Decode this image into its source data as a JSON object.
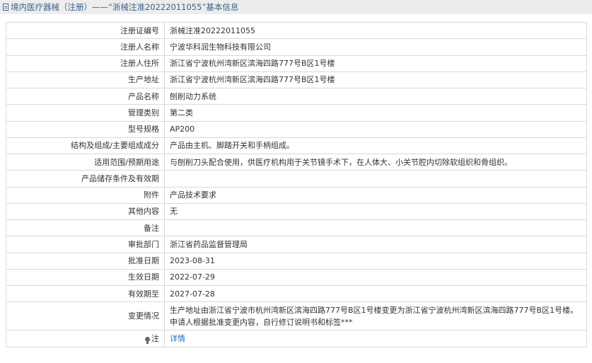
{
  "header": {
    "title": "境内医疗器械（注册）——“浙械注准20222011055”基本信息",
    "icon": "document-icon"
  },
  "rows": [
    {
      "label": "注册证编号",
      "value": "浙械注准20222011055"
    },
    {
      "label": "注册人名称",
      "value": "宁波华科润生物科技有限公司"
    },
    {
      "label": "注册人住所",
      "value": "浙江省宁波杭州湾新区滨海四路777号B区1号楼"
    },
    {
      "label": "生产地址",
      "value": "浙江省宁波杭州湾新区滨海四路777号B区1号楼"
    },
    {
      "label": "产品名称",
      "value": "刨削动力系统"
    },
    {
      "label": "管理类别",
      "value": "第二类"
    },
    {
      "label": "型号规格",
      "value": "AP200"
    },
    {
      "label": "结构及组成/主要组成成分",
      "value": "产品由主机、脚踏开关和手柄组成。"
    },
    {
      "label": "适用范围/预期用途",
      "value": "与刨削刀头配合使用，供医疗机构用于关节镜手术下，在人体大、小关节腔内切除软组织和骨组织。"
    },
    {
      "label": "产品储存条件及有效期",
      "value": ""
    },
    {
      "label": "附件",
      "value": "产品技术要求"
    },
    {
      "label": "其他内容",
      "value": "无"
    },
    {
      "label": "备注",
      "value": ""
    },
    {
      "label": "审批部门",
      "value": "浙江省药品监督管理局"
    },
    {
      "label": "批准日期",
      "value": "2023-08-31"
    },
    {
      "label": "生效日期",
      "value": "2022-07-29"
    },
    {
      "label": "有效期至",
      "value": "2027-07-28"
    },
    {
      "label": "变更情况",
      "value": "生产地址由浙江省宁波市杭州湾新区滨海四路777号B区1号楼变更为浙江省宁波杭州湾新区滨海四路777号B区1号楼。申请人根据批准变更内容，自行修订说明书和标签***"
    }
  ],
  "footer_row": {
    "label": "注",
    "link_text": "详情",
    "icon": "lightbulb-icon"
  },
  "colors": {
    "title_bar_bg": "#ededed",
    "title_text": "#3a5f8a",
    "border": "#d9d9d9",
    "link": "#1f6fc5"
  }
}
